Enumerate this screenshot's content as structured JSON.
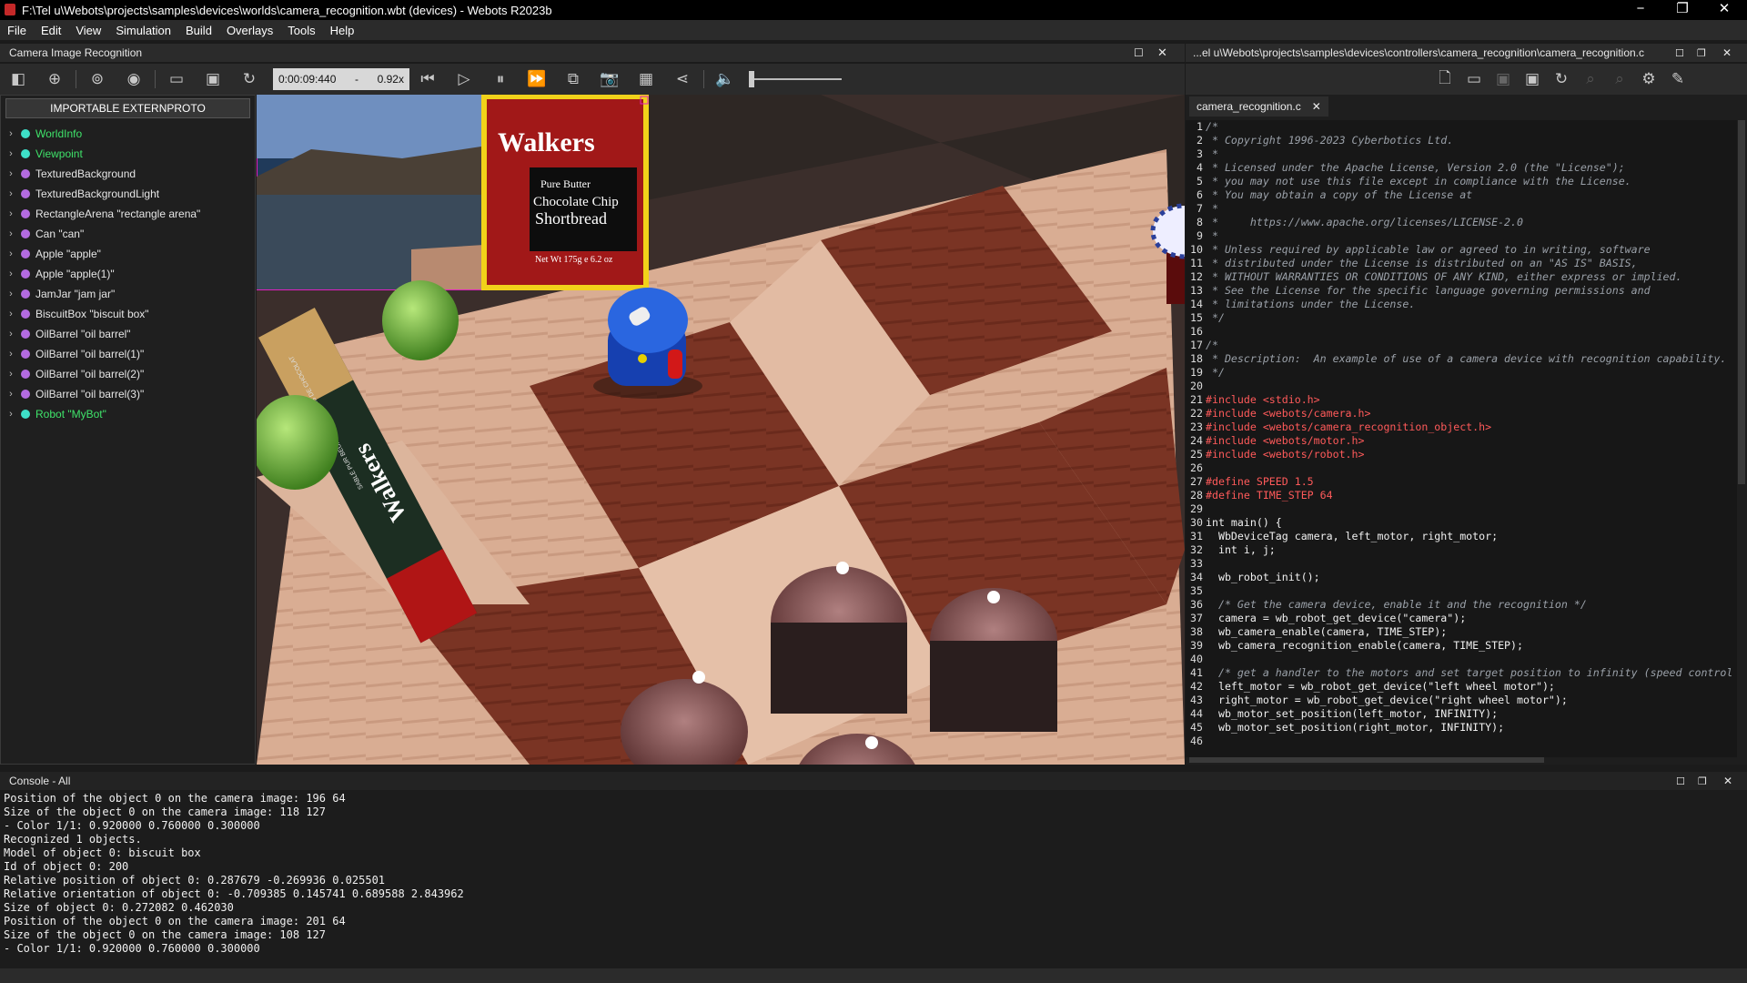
{
  "window": {
    "title": "F:\\Tel u\\Webots\\projects\\samples\\devices\\worlds\\camera_recognition.wbt (devices) - Webots R2023b",
    "minimize": "−",
    "maximize": "❐",
    "close": "✕"
  },
  "menu": [
    "File",
    "Edit",
    "View",
    "Simulation",
    "Build",
    "Overlays",
    "Tools",
    "Help"
  ],
  "scene_dock": {
    "title": "Camera Image Recognition"
  },
  "editor_dock": {
    "title": "...el u\\Webots\\projects\\samples\\devices\\controllers\\camera_recognition\\camera_recognition.c"
  },
  "sim": {
    "time": "0:00:09:440",
    "dash": "-",
    "speed": "0.92x"
  },
  "scene_tree": {
    "button": "IMPORTABLE EXTERNPROTO",
    "items": [
      {
        "label": "WorldInfo",
        "color": "#3ee0c8",
        "green": true
      },
      {
        "label": "Viewpoint",
        "color": "#3ee0c8",
        "green": true
      },
      {
        "label": "TexturedBackground",
        "color": "#b36be0",
        "green": false
      },
      {
        "label": "TexturedBackgroundLight",
        "color": "#b36be0",
        "green": false
      },
      {
        "label": "RectangleArena \"rectangle arena\"",
        "color": "#b36be0",
        "green": false
      },
      {
        "label": "Can \"can\"",
        "color": "#b36be0",
        "green": false
      },
      {
        "label": "Apple \"apple\"",
        "color": "#b36be0",
        "green": false
      },
      {
        "label": "Apple \"apple(1)\"",
        "color": "#b36be0",
        "green": false
      },
      {
        "label": "JamJar \"jam jar\"",
        "color": "#b36be0",
        "green": false
      },
      {
        "label": "BiscuitBox \"biscuit box\"",
        "color": "#b36be0",
        "green": false
      },
      {
        "label": "OilBarrel \"oil barrel\"",
        "color": "#b36be0",
        "green": false
      },
      {
        "label": "OilBarrel \"oil barrel(1)\"",
        "color": "#b36be0",
        "green": false
      },
      {
        "label": "OilBarrel \"oil barrel(2)\"",
        "color": "#b36be0",
        "green": false
      },
      {
        "label": "OilBarrel \"oil barrel(3)\"",
        "color": "#b36be0",
        "green": false
      },
      {
        "label": "Robot \"MyBot\"",
        "color": "#3ee0c8",
        "green": true
      }
    ]
  },
  "camera_overlay": {
    "brand": "Walkers",
    "line1": "Pure Butter",
    "line2": "Chocolate Chip",
    "line3": "Shortbread",
    "weight": "Net Wt 175g e 6.2 oz"
  },
  "scene_labels": {
    "box_brand": "Walkers",
    "box_side": "SABLÉ PUR BEURR AUX PÉPITES DE CHOCOLAT"
  },
  "editor": {
    "tab": "camera_recognition.c",
    "lines": [
      {
        "n": "1",
        "t": "/*",
        "c": "cmt"
      },
      {
        "n": "2",
        "t": " * Copyright 1996-2023 Cyberbotics Ltd.",
        "c": "cmt"
      },
      {
        "n": "3",
        "t": " *",
        "c": "cmt"
      },
      {
        "n": "4",
        "t": " * Licensed under the Apache License, Version 2.0 (the \"License\");",
        "c": "cmt"
      },
      {
        "n": "5",
        "t": " * you may not use this file except in compliance with the License.",
        "c": "cmt"
      },
      {
        "n": "6",
        "t": " * You may obtain a copy of the License at",
        "c": "cmt"
      },
      {
        "n": "7",
        "t": " *",
        "c": "cmt"
      },
      {
        "n": "8",
        "t": " *     https://www.apache.org/licenses/LICENSE-2.0",
        "c": "cmt"
      },
      {
        "n": "9",
        "t": " *",
        "c": "cmt"
      },
      {
        "n": "10",
        "t": " * Unless required by applicable law or agreed to in writing, software",
        "c": "cmt"
      },
      {
        "n": "11",
        "t": " * distributed under the License is distributed on an \"AS IS\" BASIS,",
        "c": "cmt"
      },
      {
        "n": "12",
        "t": " * WITHOUT WARRANTIES OR CONDITIONS OF ANY KIND, either express or implied.",
        "c": "cmt"
      },
      {
        "n": "13",
        "t": " * See the License for the specific language governing permissions and",
        "c": "cmt"
      },
      {
        "n": "14",
        "t": " * limitations under the License.",
        "c": "cmt"
      },
      {
        "n": "15",
        "t": " */",
        "c": "cmt"
      },
      {
        "n": "16",
        "t": "",
        "c": "code"
      },
      {
        "n": "17",
        "t": "/*",
        "c": "cmt"
      },
      {
        "n": "18",
        "t": " * Description:  An example of use of a camera device with recognition capability.",
        "c": "cmt"
      },
      {
        "n": "19",
        "t": " */",
        "c": "cmt"
      },
      {
        "n": "20",
        "t": "",
        "c": "code"
      },
      {
        "n": "21",
        "t": "#include <stdio.h>",
        "c": "pp"
      },
      {
        "n": "22",
        "t": "#include <webots/camera.h>",
        "c": "pp"
      },
      {
        "n": "23",
        "t": "#include <webots/camera_recognition_object.h>",
        "c": "pp"
      },
      {
        "n": "24",
        "t": "#include <webots/motor.h>",
        "c": "pp"
      },
      {
        "n": "25",
        "t": "#include <webots/robot.h>",
        "c": "pp"
      },
      {
        "n": "26",
        "t": "",
        "c": "code"
      },
      {
        "n": "27",
        "t": "#define SPEED 1.5",
        "c": "pp"
      },
      {
        "n": "28",
        "t": "#define TIME_STEP 64",
        "c": "pp"
      },
      {
        "n": "29",
        "t": "",
        "c": "code"
      },
      {
        "n": "30",
        "t": "int main() {",
        "c": "code"
      },
      {
        "n": "31",
        "t": "  WbDeviceTag camera, left_motor, right_motor;",
        "c": "code"
      },
      {
        "n": "32",
        "t": "  int i, j;",
        "c": "code"
      },
      {
        "n": "33",
        "t": "",
        "c": "code"
      },
      {
        "n": "34",
        "t": "  wb_robot_init();",
        "c": "code"
      },
      {
        "n": "35",
        "t": "",
        "c": "code"
      },
      {
        "n": "36",
        "t": "  /* Get the camera device, enable it and the recognition */",
        "c": "cmt"
      },
      {
        "n": "37",
        "t": "  camera = wb_robot_get_device(\"camera\");",
        "c": "code"
      },
      {
        "n": "38",
        "t": "  wb_camera_enable(camera, TIME_STEP);",
        "c": "code"
      },
      {
        "n": "39",
        "t": "  wb_camera_recognition_enable(camera, TIME_STEP);",
        "c": "code"
      },
      {
        "n": "40",
        "t": "",
        "c": "code"
      },
      {
        "n": "41",
        "t": "  /* get a handler to the motors and set target position to infinity (speed control",
        "c": "cmt"
      },
      {
        "n": "42",
        "t": "  left_motor = wb_robot_get_device(\"left wheel motor\");",
        "c": "code"
      },
      {
        "n": "43",
        "t": "  right_motor = wb_robot_get_device(\"right wheel motor\");",
        "c": "code"
      },
      {
        "n": "44",
        "t": "  wb_motor_set_position(left_motor, INFINITY);",
        "c": "code"
      },
      {
        "n": "45",
        "t": "  wb_motor_set_position(right_motor, INFINITY);",
        "c": "code"
      },
      {
        "n": "46",
        "t": "",
        "c": "code"
      }
    ]
  },
  "console": {
    "title": "Console - All",
    "lines": [
      "Position of the object 0 on the camera image: 196 64",
      "Size of the object 0 on the camera image: 118 127",
      "- Color 1/1: 0.920000 0.760000 0.300000",
      "Recognized 1 objects.",
      "Model of object 0: biscuit box",
      "Id of object 0: 200",
      "Relative position of object 0: 0.287679 -0.269936 0.025501",
      "Relative orientation of object 0: -0.709385 0.145741 0.689588 2.843962",
      "Size of object 0: 0.272082 0.462030",
      "Position of the object 0 on the camera image: 201 64",
      "Size of the object 0 on the camera image: 108 127",
      "- Color 1/1: 0.920000 0.760000 0.300000"
    ]
  }
}
